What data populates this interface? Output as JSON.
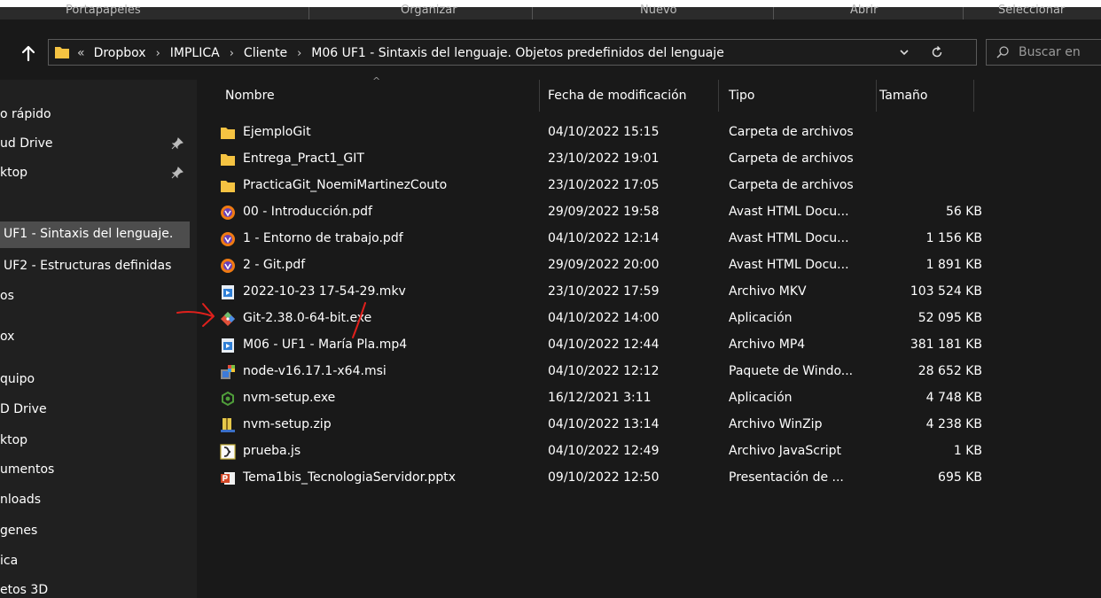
{
  "ribbon": {
    "groups": [
      "Portapapeles",
      "Organizar",
      "Nuevo",
      "Abrir",
      "Seleccionar"
    ]
  },
  "address": {
    "crumbs": [
      "Dropbox",
      "IMPLICA",
      "Cliente",
      "M06 UF1 - Sintaxis del lenguaje. Objetos predefinidos del lenguaje"
    ]
  },
  "search": {
    "placeholder": "Buscar en"
  },
  "sidebar": {
    "items": [
      {
        "label": "o rápido",
        "pinned": false
      },
      {
        "label": "ud Drive",
        "pinned": true
      },
      {
        "label": "ktop",
        "pinned": true
      },
      {
        "label": "UF1 - Sintaxis del lenguaje.",
        "selected": true
      },
      {
        "label": "UF2 - Estructuras definidas"
      },
      {
        "label": "os"
      },
      {
        "label": "ox"
      },
      {
        "label": "quipo"
      },
      {
        "label": "D Drive"
      },
      {
        "label": "ktop"
      },
      {
        "label": "umentos"
      },
      {
        "label": "nloads"
      },
      {
        "label": "genes"
      },
      {
        "label": "ica"
      },
      {
        "label": "etos 3D"
      }
    ]
  },
  "columns": {
    "name": "Nombre",
    "date": "Fecha de modificación",
    "type": "Tipo",
    "size": "Tamaño"
  },
  "files": [
    {
      "name": "EjemploGit",
      "date": "04/10/2022 15:15",
      "type": "Carpeta de archivos",
      "size": "",
      "icon": "folder-icon"
    },
    {
      "name": "Entrega_Pract1_GIT",
      "date": "23/10/2022 19:01",
      "type": "Carpeta de archivos",
      "size": "",
      "icon": "folder-icon"
    },
    {
      "name": "PracticaGit_NoemiMartinezCouto",
      "date": "23/10/2022 17:05",
      "type": "Carpeta de archivos",
      "size": "",
      "icon": "folder-icon"
    },
    {
      "name": "00 - Introducción.pdf",
      "date": "29/09/2022 19:58",
      "type": "Avast HTML Docu...",
      "size": "56 KB",
      "icon": "pdf-icon"
    },
    {
      "name": "1 - Entorno de trabajo.pdf",
      "date": "04/10/2022 12:14",
      "type": "Avast HTML Docu...",
      "size": "1 156 KB",
      "icon": "pdf-icon"
    },
    {
      "name": "2 - Git.pdf",
      "date": "29/09/2022 20:00",
      "type": "Avast HTML Docu...",
      "size": "1 891 KB",
      "icon": "pdf-icon"
    },
    {
      "name": "2022-10-23 17-54-29.mkv",
      "date": "23/10/2022 17:59",
      "type": "Archivo MKV",
      "size": "103 524 KB",
      "icon": "video-icon"
    },
    {
      "name": "Git-2.38.0-64-bit.exe",
      "date": "04/10/2022 14:00",
      "type": "Aplicación",
      "size": "52 095 KB",
      "icon": "git-icon"
    },
    {
      "name": "M06 - UF1 - María Pla.mp4",
      "date": "04/10/2022 12:44",
      "type": "Archivo MP4",
      "size": "381 181 KB",
      "icon": "video-icon"
    },
    {
      "name": "node-v16.17.1-x64.msi",
      "date": "04/10/2022 12:12",
      "type": "Paquete de Windo...",
      "size": "28 652 KB",
      "icon": "installer-icon"
    },
    {
      "name": "nvm-setup.exe",
      "date": "16/12/2021 3:11",
      "type": "Aplicación",
      "size": "4 748 KB",
      "icon": "exe-icon"
    },
    {
      "name": "nvm-setup.zip",
      "date": "04/10/2022 13:14",
      "type": "Archivo WinZip",
      "size": "4 238 KB",
      "icon": "zip-icon"
    },
    {
      "name": "prueba.js",
      "date": "04/10/2022 12:49",
      "type": "Archivo JavaScript",
      "size": "1 KB",
      "icon": "js-icon"
    },
    {
      "name": "Tema1bis_TecnologiaServidor.pptx",
      "date": "09/10/2022 12:50",
      "type": "Presentación de ...",
      "size": "695 KB",
      "icon": "pptx-icon"
    }
  ],
  "colors": {
    "background": "#191919",
    "sidebar": "#202020",
    "selected": "#4d4d4d",
    "folder": "#f5c342",
    "annotation": "#e0201c"
  }
}
